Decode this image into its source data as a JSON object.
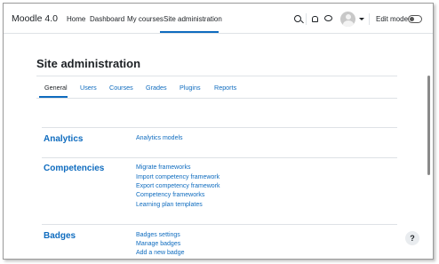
{
  "navbar": {
    "brand": "Moodle 4.0",
    "links": [
      "Home",
      "Dashboard",
      "My courses",
      "Site administration"
    ],
    "edit_mode_label": "Edit mode",
    "icons": [
      "search-icon",
      "bell-icon",
      "chat-icon",
      "avatar",
      "chevron-down-icon",
      "toggle"
    ]
  },
  "page": {
    "title": "Site administration",
    "tabs": [
      "General",
      "Users",
      "Courses",
      "Grades",
      "Plugins",
      "Reports"
    ],
    "sections": [
      {
        "heading": "Analytics",
        "links": [
          "Analytics models"
        ]
      },
      {
        "heading": "Competencies",
        "links": [
          "Migrate frameworks",
          "Import competency framework",
          "Export competency framework",
          "Competency frameworks",
          "Learning plan templates"
        ]
      },
      {
        "heading": "Badges",
        "links": [
          "Badges settings",
          "Manage badges",
          "Add a new badge"
        ]
      }
    ]
  },
  "help": {
    "label": "?"
  },
  "colors": {
    "accent": "#0f6cbf",
    "text": "#1d2125",
    "rule": "#dee2e6"
  }
}
